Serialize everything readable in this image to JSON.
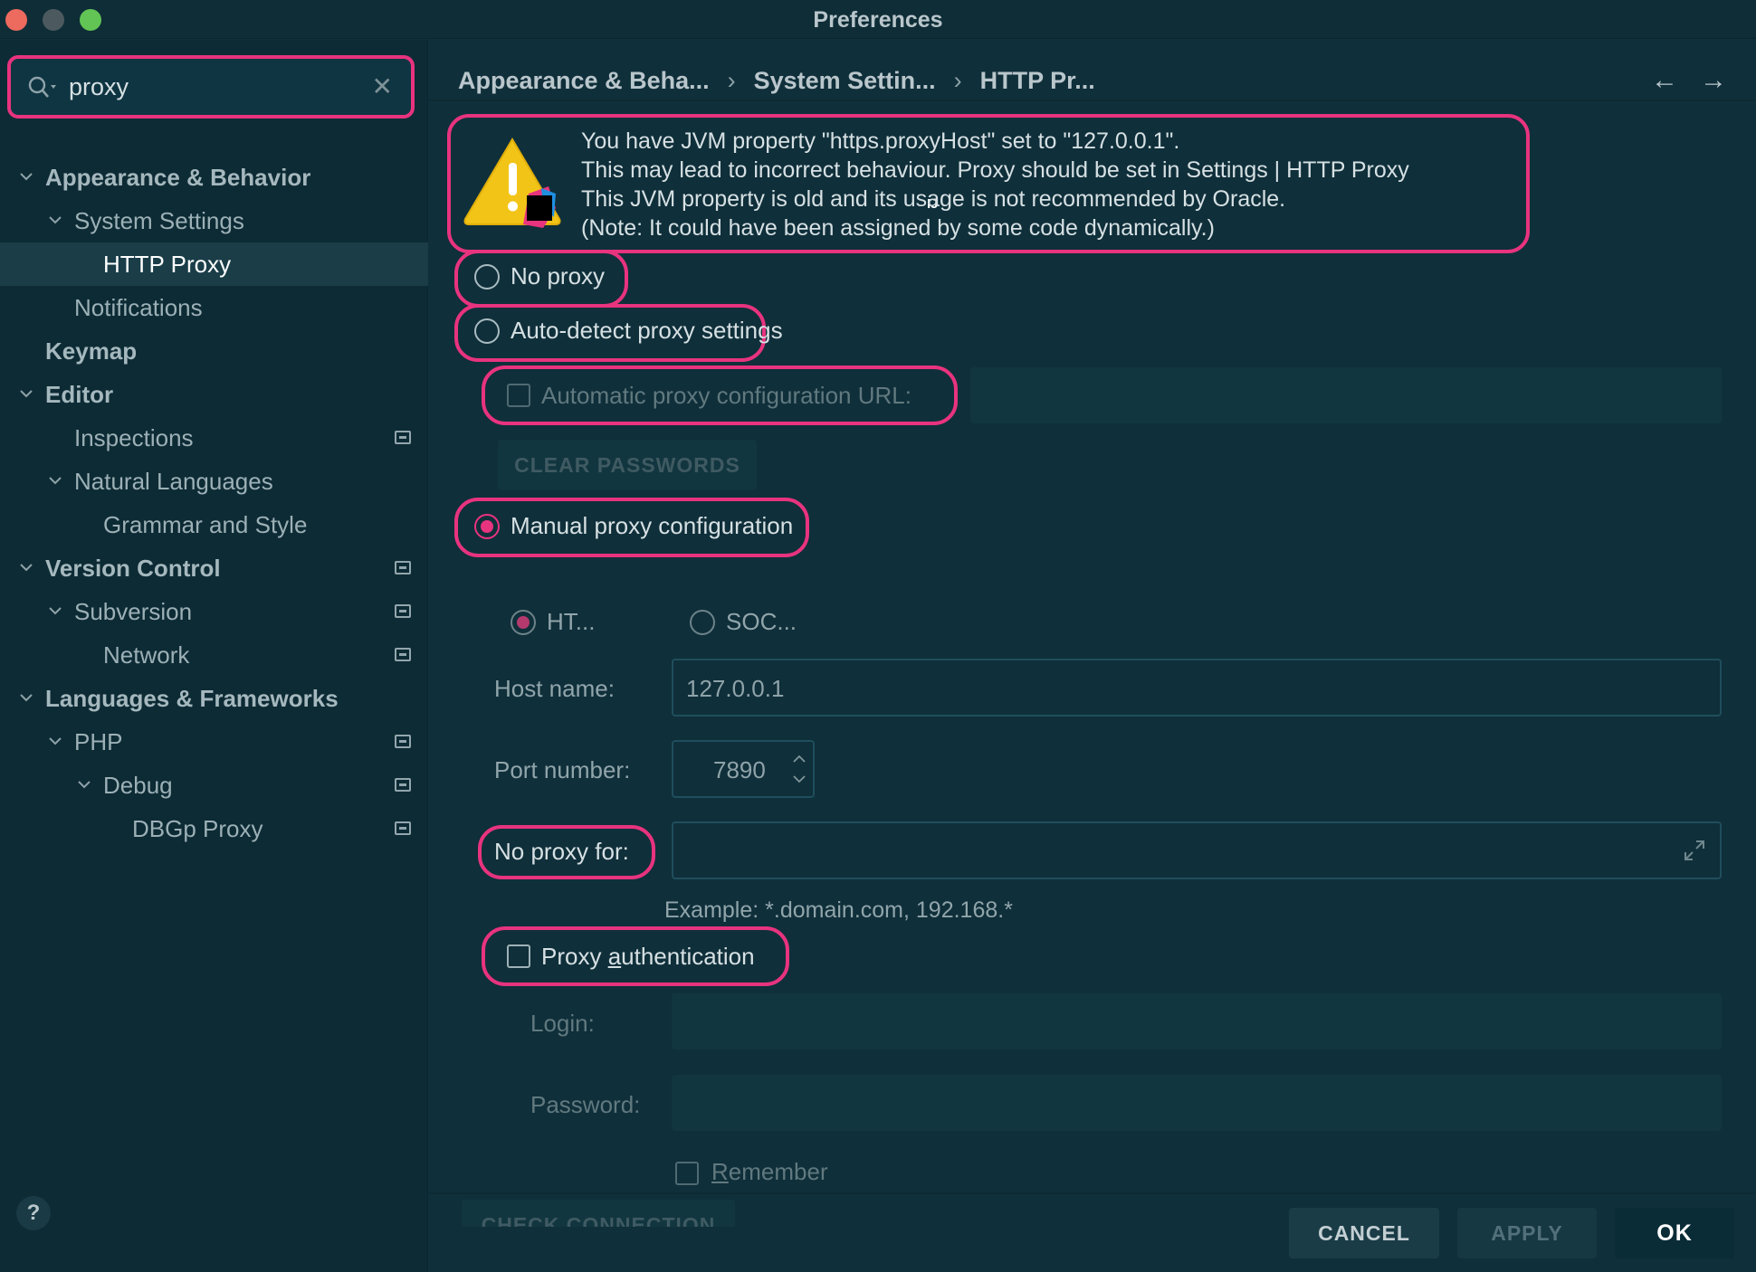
{
  "window": {
    "title": "Preferences"
  },
  "search": {
    "value": "proxy"
  },
  "sidebar": {
    "items": [
      {
        "label": "Appearance & Behavior"
      },
      {
        "label": "System Settings"
      },
      {
        "label": "HTTP Proxy"
      },
      {
        "label": "Notifications"
      },
      {
        "label": "Keymap"
      },
      {
        "label": "Editor"
      },
      {
        "label": "Inspections"
      },
      {
        "label": "Natural Languages"
      },
      {
        "label": "Grammar and Style"
      },
      {
        "label": "Version Control"
      },
      {
        "label": "Subversion"
      },
      {
        "label": "Network"
      },
      {
        "label": "Languages & Frameworks"
      },
      {
        "label": "PHP"
      },
      {
        "label": "Debug"
      },
      {
        "label": "DBGp Proxy"
      }
    ]
  },
  "breadcrumb": [
    "Appearance & Beha...",
    "System Settin...",
    "HTTP Pr..."
  ],
  "warning": {
    "lines": [
      "You have JVM property \"https.proxyHost\" set to \"127.0.0.1\".",
      "This may lead to incorrect behaviour. Proxy should be set in Settings | HTTP Proxy",
      "This JVM property is old and its usage is not recommended by Oracle.",
      "(Note: It could have been assigned by some code dynamically.)"
    ],
    "badge": "IJ"
  },
  "proxy": {
    "no_proxy": "No proxy",
    "auto_detect": "Auto-detect proxy settings",
    "auto_config_url": "Automatic proxy configuration URL:",
    "clear_passwords": "CLEAR PASSWORDS",
    "manual": "Manual proxy configuration",
    "http": "HT...",
    "socks": "SOC...",
    "host_label": "Host name:",
    "host_value": "127.0.0.1",
    "port_label": "Port number:",
    "port_value": "7890",
    "no_proxy_for": "No proxy for:",
    "example": "Example: *.domain.com, 192.168.*",
    "auth_a": "Proxy ",
    "auth_u": "a",
    "auth_b": "uthentication",
    "login": "Login:",
    "password": "Password:",
    "remember_u": "R",
    "remember_b": "emember",
    "check_connection": "CHECK CONNECTION"
  },
  "footer": {
    "help": "?",
    "cancel": "CANCEL",
    "apply": "APPLY",
    "ok": "OK"
  },
  "colors": {
    "accent": "#e8337f",
    "background": "#0f2f3a",
    "sidebar": "#0d2b35"
  }
}
